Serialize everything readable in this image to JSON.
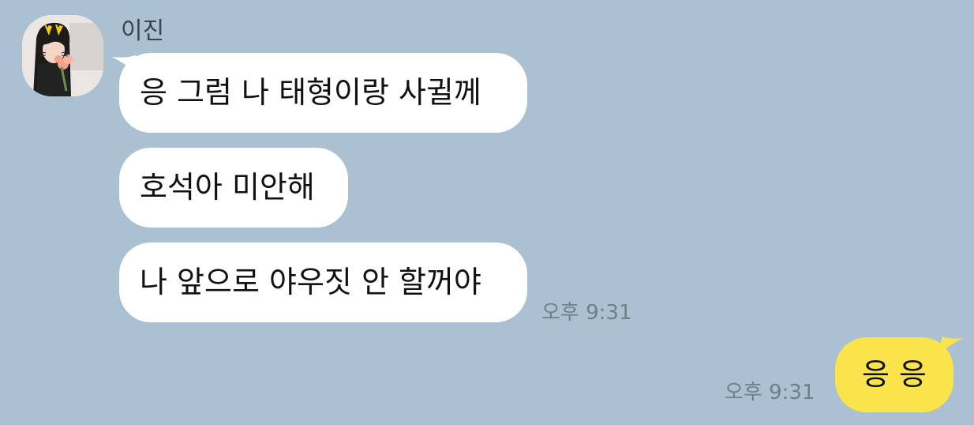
{
  "chat": {
    "sender_name": "이진",
    "incoming_messages": [
      "응 그럼 나 태형이랑 사귈께",
      "호석아 미안해",
      "나 앞으로 야우짓 안 할꺼야"
    ],
    "incoming_time": "오후 9:31",
    "outgoing_message": "응 응",
    "outgoing_time": "오후 9:31"
  },
  "colors": {
    "background": "#abc1d1",
    "incoming_bubble": "#ffffff",
    "outgoing_bubble": "#fbe44b",
    "timestamp": "#6f7f8c"
  }
}
